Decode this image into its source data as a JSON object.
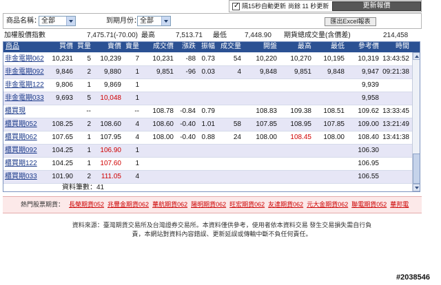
{
  "colors": {
    "header_bg": "#2b5193",
    "row_alt_bg": "#e6e6f6",
    "link_text": "#1b3a8a",
    "price_up": "#d00000",
    "refresh_button_bg": "#575757",
    "hot_bar_bg": "#fce9e9",
    "hot_link": "#cc0000"
  },
  "toolbar": {
    "auto_refresh_checked": true,
    "auto_refresh_label": "隔15秒自動更新",
    "countdown_label": "尚餘 11 秒更新",
    "refresh_button": "更新報價"
  },
  "filters": {
    "product_label": "商品名稱：",
    "product_value": "全部",
    "expiry_label": "到期月份：",
    "expiry_value": "全部",
    "export_button": "匯出Excel報表"
  },
  "index_summary": {
    "name": "加權股價指數",
    "value": "7,475.71(-70.00)",
    "high_label": "最高",
    "high": "7,513.71",
    "low_label": "最低",
    "low": "7,448.90",
    "volume_label": "期貨總成交量(含價差)",
    "volume": "214,458"
  },
  "table": {
    "columns": [
      "商品",
      "買價",
      "買量",
      "賣價",
      "賣量",
      "成交價",
      "漲跌",
      "振幅",
      "成交量",
      "開盤",
      "最高",
      "最低",
      "參考價",
      "時間"
    ],
    "rows": [
      {
        "cells": [
          "非金電期062",
          "10,231",
          "5",
          "10,239",
          "7",
          "10,231",
          "-88",
          "0.73",
          "54",
          "10,220",
          "10,270",
          "10,195",
          "10,319",
          "13:43:52"
        ],
        "red": []
      },
      {
        "cells": [
          "非金電期092",
          "9,846",
          "2",
          "9,880",
          "1",
          "9,851",
          "-96",
          "0.03",
          "4",
          "9,848",
          "9,851",
          "9,848",
          "9,947",
          "09:21:38"
        ],
        "red": []
      },
      {
        "cells": [
          "非金電期122",
          "9,806",
          "1",
          "9,869",
          "1",
          "",
          "",
          "",
          "",
          "",
          "",
          "",
          "9,939",
          ""
        ],
        "red": []
      },
      {
        "cells": [
          "非金電期033",
          "9,693",
          "5",
          "10,048",
          "1",
          "",
          "",
          "",
          "",
          "",
          "",
          "",
          "9,958",
          ""
        ],
        "red": [
          3
        ]
      },
      {
        "cells": [
          "櫃買現",
          "",
          "--",
          "",
          "--",
          "108.78",
          "-0.84",
          "0.79",
          "",
          "108.83",
          "109.38",
          "108.51",
          "109.62",
          "13:33:45"
        ],
        "red": []
      },
      {
        "cells": [
          "櫃買期052",
          "108.25",
          "2",
          "108.60",
          "4",
          "108.60",
          "-0.40",
          "1.01",
          "58",
          "107.85",
          "108.95",
          "107.85",
          "109.00",
          "13:21:49"
        ],
        "red": []
      },
      {
        "cells": [
          "櫃買期062",
          "107.65",
          "1",
          "107.95",
          "4",
          "108.00",
          "-0.40",
          "0.88",
          "24",
          "108.00",
          "108.45",
          "108.00",
          "108.40",
          "13:41:38"
        ],
        "red": [
          10
        ]
      },
      {
        "cells": [
          "櫃買期092",
          "104.25",
          "1",
          "106.90",
          "1",
          "",
          "",
          "",
          "",
          "",
          "",
          "",
          "106.30",
          ""
        ],
        "red": [
          3
        ]
      },
      {
        "cells": [
          "櫃買期122",
          "104.25",
          "1",
          "107.60",
          "1",
          "",
          "",
          "",
          "",
          "",
          "",
          "",
          "106.95",
          ""
        ],
        "red": [
          3
        ]
      },
      {
        "cells": [
          "櫃買期033",
          "101.90",
          "2",
          "111.05",
          "4",
          "",
          "",
          "",
          "",
          "",
          "",
          "",
          "106.55",
          ""
        ],
        "red": [
          3
        ]
      }
    ],
    "record_count": "資料筆數：41"
  },
  "scrollbar": {
    "scroll_fraction": 1.0
  },
  "hot_futures": {
    "label": "熱門股票期貨：",
    "links": [
      "長榮期貨052",
      "兆豐金期貨062",
      "華航期貨062",
      "陽明期貨062",
      "旺宏期貨062",
      "友達期貨062",
      "元大金期貨062",
      "聯電期貨052",
      "華邦電"
    ]
  },
  "footer": {
    "lines": [
      "資料來源：臺灣期貨交易所及台灣證券交易所。本資料僅供參考，使用者依本資料交易 發生交易損失需自行負",
      "責，本網站對資料內容錯誤、更新延誤或傳輸中斷不負任何責任。"
    ]
  },
  "watermark": "#2038546"
}
